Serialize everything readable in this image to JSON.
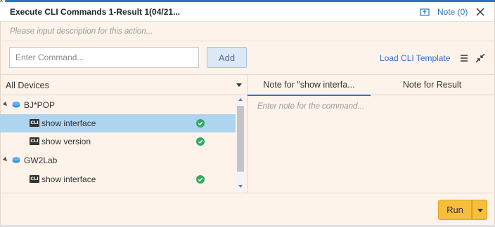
{
  "header": {
    "title": "Execute CLI Commands 1-Result 1(04/21...",
    "note_label": "Note (0)"
  },
  "description_placeholder": "Please input description for this action...",
  "command_bar": {
    "input_placeholder": "Enter Command...",
    "input_value": "",
    "add_label": "Add",
    "load_template_label": "Load CLI Template"
  },
  "device_selector": {
    "selected": "All Devices"
  },
  "tree": [
    {
      "type": "device",
      "label": "BJ*POP"
    },
    {
      "type": "command",
      "label": "show interface",
      "status": "success",
      "selected": true
    },
    {
      "type": "command",
      "label": "show version",
      "status": "success",
      "selected": false
    },
    {
      "type": "device",
      "label": "GW2Lab"
    },
    {
      "type": "command",
      "label": "show interface",
      "status": "success",
      "selected": false
    }
  ],
  "cli_badge": "CLI",
  "note_tabs": {
    "tab1": "Note for \"show interfa...",
    "tab2": "Note for Result",
    "placeholder": "Enter note for the command..."
  },
  "run": {
    "label": "Run"
  },
  "colors": {
    "accent": "#2f74c0",
    "panel_bg": "#fdf3ea",
    "selection": "#aed4f0",
    "success": "#2eaa62",
    "run_button": "#f5be3c"
  }
}
